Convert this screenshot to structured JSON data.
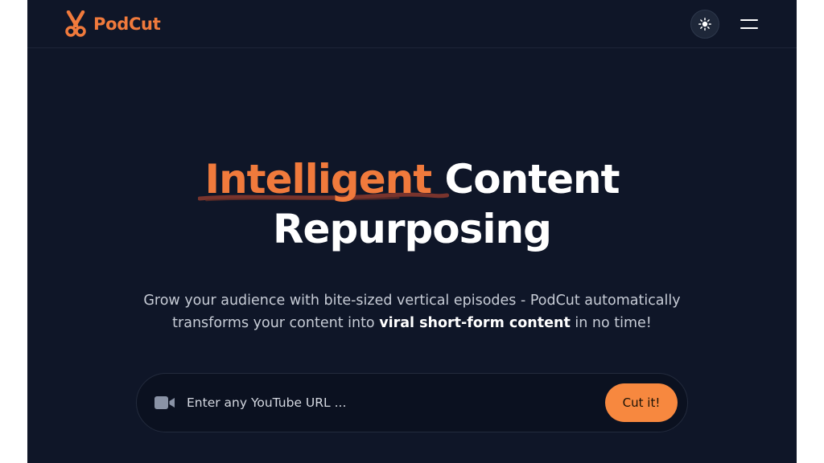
{
  "header": {
    "brand_name": "PodCut",
    "brand_icon": "scissors-icon",
    "theme_toggle_icon": "sun-icon",
    "menu_icon": "hamburger-menu-icon"
  },
  "hero": {
    "title_accent": "Intelligent",
    "title_rest_line1": "Content",
    "title_line2": "Repurposing",
    "subtitle_part1": "Grow your audience with bite-sized vertical episodes - PodCut automatically transforms your content into ",
    "subtitle_bold": "viral short-form content",
    "subtitle_part2": " in no time!"
  },
  "url_form": {
    "icon": "video-camera-icon",
    "placeholder": "Enter any YouTube URL ...",
    "value": "",
    "submit_label": "Cut it!"
  },
  "colors": {
    "background": "#0f1628",
    "accent": "#f07a3c",
    "button": "#f7883f",
    "text_primary": "#ffffff",
    "text_secondary": "#c7ccd6"
  }
}
